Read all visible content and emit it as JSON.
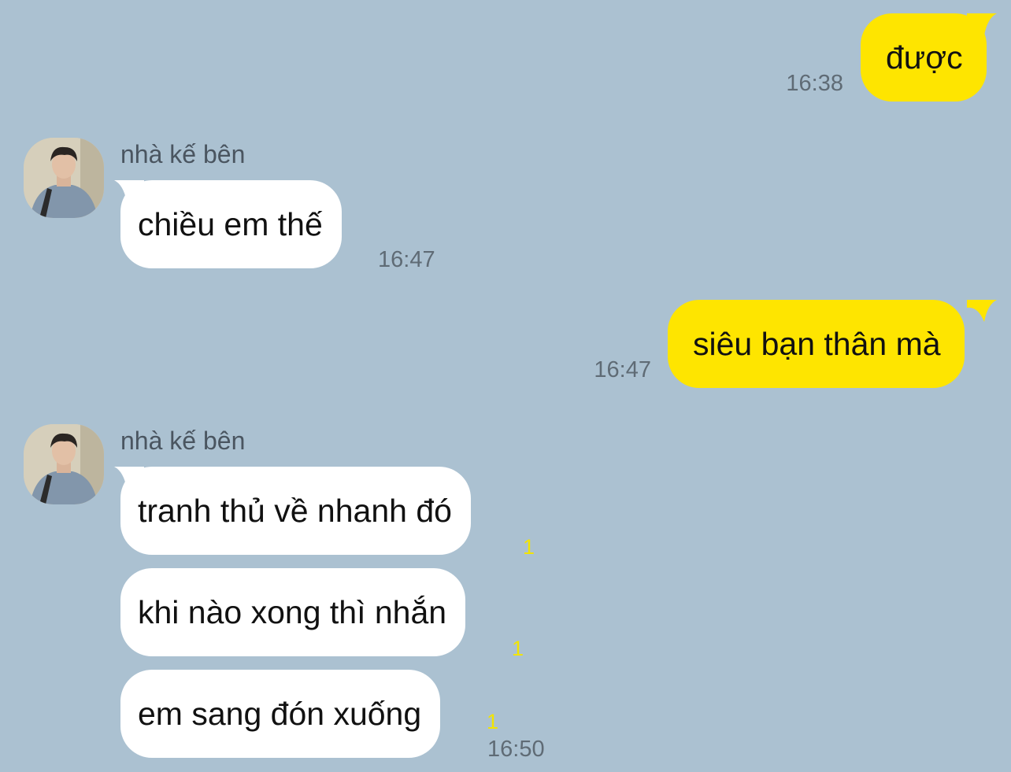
{
  "chat": {
    "colors": {
      "background": "#abc1d1",
      "outgoing_bubble": "#fee500",
      "incoming_bubble": "#ffffff",
      "unread_count": "#f2e400"
    },
    "messages": [
      {
        "direction": "outgoing",
        "text": "được",
        "time": "16:38"
      },
      {
        "direction": "incoming",
        "sender": "nhà kế bên",
        "avatar_icon": "profile-photo",
        "text": "chiều em thế",
        "time": "16:47"
      },
      {
        "direction": "outgoing",
        "text": "siêu bạn thân mà",
        "time": "16:47"
      },
      {
        "direction": "incoming",
        "sender": "nhà kế bên",
        "avatar_icon": "profile-photo",
        "text": "tranh thủ về nhanh đó",
        "unread": "1"
      },
      {
        "direction": "incoming",
        "text": "khi nào xong thì nhắn",
        "unread": "1"
      },
      {
        "direction": "incoming",
        "text": "em sang đón xuống",
        "unread": "1",
        "time": "16:50"
      }
    ]
  }
}
